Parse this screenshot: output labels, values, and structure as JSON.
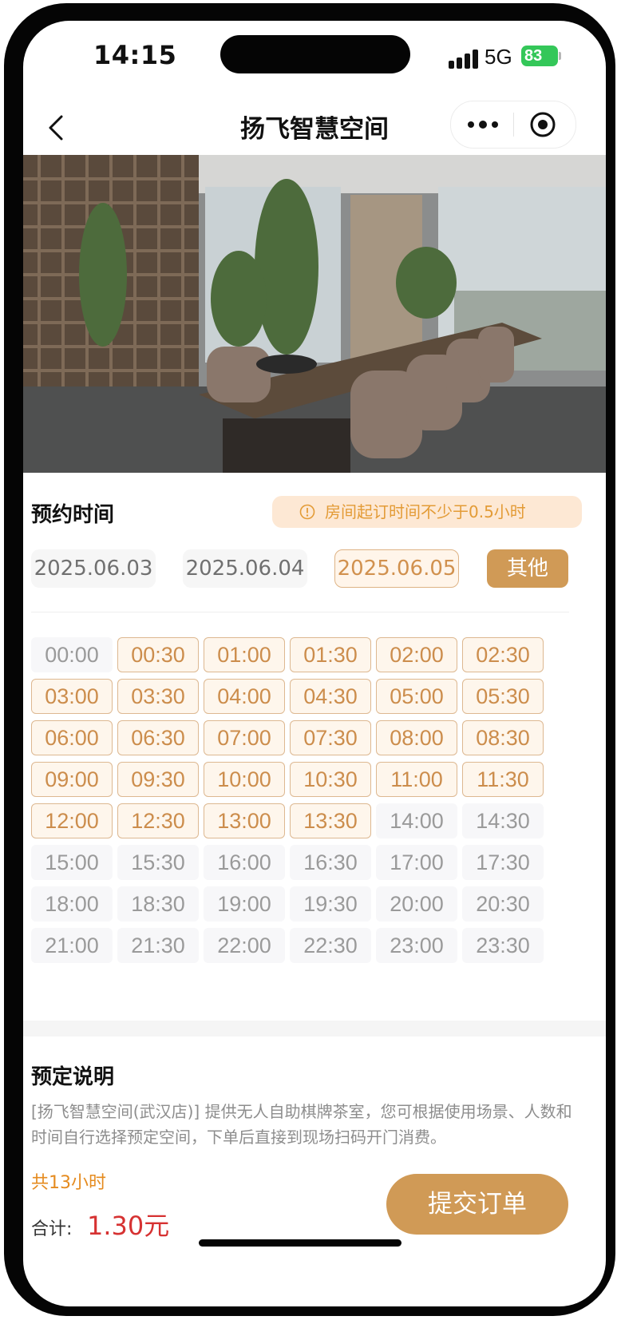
{
  "status_bar": {
    "time": "14:15",
    "network": "5G",
    "battery": "83"
  },
  "nav": {
    "title": "扬飞智慧空间"
  },
  "booking": {
    "section_title": "预约时间",
    "notice": "房间起订时间不少于0.5小时",
    "dates": [
      "2025.06.03",
      "2025.06.04",
      "2025.06.05"
    ],
    "selected_date": "2025.06.05",
    "other_label": "其他"
  },
  "slots": [
    {
      "time": "00:00",
      "selected": false
    },
    {
      "time": "00:30",
      "selected": true
    },
    {
      "time": "01:00",
      "selected": true
    },
    {
      "time": "01:30",
      "selected": true
    },
    {
      "time": "02:00",
      "selected": true
    },
    {
      "time": "02:30",
      "selected": true
    },
    {
      "time": "03:00",
      "selected": true
    },
    {
      "time": "03:30",
      "selected": true
    },
    {
      "time": "04:00",
      "selected": true
    },
    {
      "time": "04:30",
      "selected": true
    },
    {
      "time": "05:00",
      "selected": true
    },
    {
      "time": "05:30",
      "selected": true
    },
    {
      "time": "06:00",
      "selected": true
    },
    {
      "time": "06:30",
      "selected": true
    },
    {
      "time": "07:00",
      "selected": true
    },
    {
      "time": "07:30",
      "selected": true
    },
    {
      "time": "08:00",
      "selected": true
    },
    {
      "time": "08:30",
      "selected": true
    },
    {
      "time": "09:00",
      "selected": true
    },
    {
      "time": "09:30",
      "selected": true
    },
    {
      "time": "10:00",
      "selected": true
    },
    {
      "time": "10:30",
      "selected": true
    },
    {
      "time": "11:00",
      "selected": true
    },
    {
      "time": "11:30",
      "selected": true
    },
    {
      "time": "12:00",
      "selected": true
    },
    {
      "time": "12:30",
      "selected": true
    },
    {
      "time": "13:00",
      "selected": true
    },
    {
      "time": "13:30",
      "selected": true
    },
    {
      "time": "14:00",
      "selected": false
    },
    {
      "time": "14:30",
      "selected": false
    },
    {
      "time": "15:00",
      "selected": false
    },
    {
      "time": "15:30",
      "selected": false
    },
    {
      "time": "16:00",
      "selected": false
    },
    {
      "time": "16:30",
      "selected": false
    },
    {
      "time": "17:00",
      "selected": false
    },
    {
      "time": "17:30",
      "selected": false
    },
    {
      "time": "18:00",
      "selected": false
    },
    {
      "time": "18:30",
      "selected": false
    },
    {
      "time": "19:00",
      "selected": false
    },
    {
      "time": "19:30",
      "selected": false
    },
    {
      "time": "20:00",
      "selected": false
    },
    {
      "time": "20:30",
      "selected": false
    },
    {
      "time": "21:00",
      "selected": false
    },
    {
      "time": "21:30",
      "selected": false
    },
    {
      "time": "22:00",
      "selected": false
    },
    {
      "time": "22:30",
      "selected": false
    },
    {
      "time": "23:00",
      "selected": false
    },
    {
      "time": "23:30",
      "selected": false
    }
  ],
  "description": {
    "title": "预定说明",
    "text": "[扬飞智慧空间(武汉店)] 提供无人自助棋牌茶室，您可根据使用场景、人数和时间自行选择预定空间，下单后直接到现场扫码开门消费。"
  },
  "summary": {
    "hours": "共13小时",
    "total_label": "合计:",
    "total_value": "1.30元",
    "submit_label": "提交订单"
  },
  "colors": {
    "accent": "#d09a56",
    "selected_bg": "#fef6ec",
    "selected_text": "#cc8d4c",
    "price": "#d63232",
    "hours_text": "#e58b1f"
  }
}
